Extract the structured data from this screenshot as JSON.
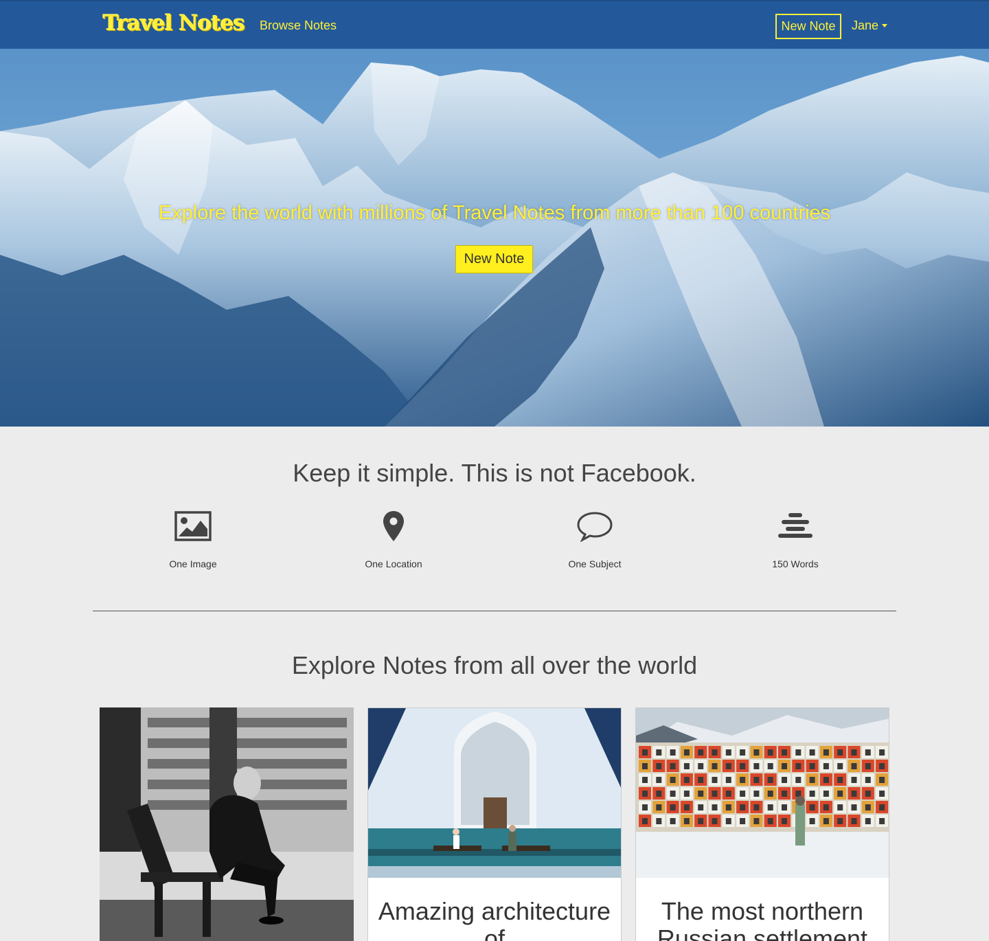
{
  "navbar": {
    "logo": "Travel Notes",
    "browse_label": "Browse Notes",
    "new_note_label": "New Note",
    "user_label": "Jane"
  },
  "hero": {
    "headline": "Explore the world with millions of Travel Notes from more than 100 countries",
    "cta_label": "New Note"
  },
  "features": {
    "title": "Keep it simple. This is not Facebook.",
    "items": [
      {
        "icon": "image-icon",
        "label": "One Image"
      },
      {
        "icon": "map-pin-icon",
        "label": "One Location"
      },
      {
        "icon": "speech-bubble-icon",
        "label": "One Subject"
      },
      {
        "icon": "text-lines-icon",
        "label": "150 Words"
      }
    ]
  },
  "explore": {
    "title": "Explore Notes from all over the world",
    "cards": [
      {
        "title": ""
      },
      {
        "title": "Amazing architecture of"
      },
      {
        "title": "The most northern Russian settlement"
      }
    ]
  },
  "colors": {
    "navbar": "#23599a",
    "accent_yellow": "#ffef3a",
    "page_bg": "#ececec"
  }
}
